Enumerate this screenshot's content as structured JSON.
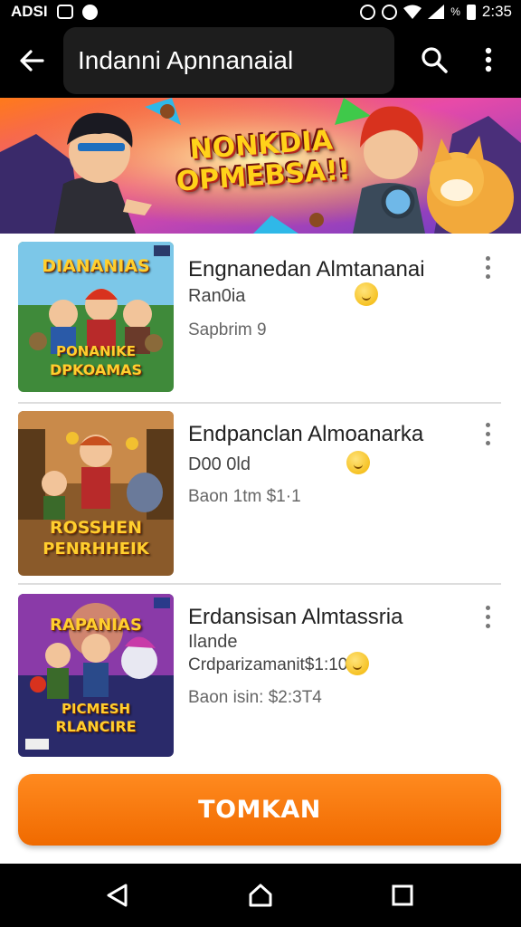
{
  "status_bar": {
    "left_text": "ADSI",
    "percent": "%",
    "time": "2:35",
    "icons": [
      "notification-box-icon",
      "notification-dot-icon",
      "alarm-icon",
      "alarm-icon",
      "wifi-icon",
      "signal-icon",
      "battery-icon"
    ]
  },
  "app_bar": {
    "title": "Indanni Apnnanaial",
    "icons": [
      "back-arrow-icon",
      "search-icon",
      "more-vert-icon"
    ]
  },
  "banner": {
    "title_line1": "NONKDIA",
    "title_line2": "OPMEBSA!!"
  },
  "items": [
    {
      "thumb_top": "DIANANIAS",
      "thumb_bottom_1": "PONANIKE",
      "thumb_bottom_2": "DPKOAMAS",
      "title": "Engnanedan Almtananai",
      "subtitle": "Ran0ia",
      "meta": "Sapbrim 9"
    },
    {
      "thumb_top": "",
      "thumb_bottom_1": "ROSSHEN",
      "thumb_bottom_2": "PENRHHEIK",
      "title": "Endpanclan Almoanarka",
      "subtitle": "D00 0ld",
      "meta": "Baon 1tm $1·1"
    },
    {
      "thumb_top": "RAPANIAS",
      "thumb_bottom_1": "PICMESH",
      "thumb_bottom_2": "RLANCIRE",
      "title": "Erdansisan Almtassria",
      "subtitle": "Ilande",
      "subtitle2": "Crdparizamanit$1:10",
      "meta": "Baon isin: $2:3T4"
    }
  ],
  "cta": {
    "label": "TOMKAN"
  },
  "nav": {
    "icons": [
      "back-triangle-icon",
      "home-icon",
      "recents-square-icon"
    ]
  },
  "colors": {
    "accent": "#f47a0c",
    "app_bar": "#000000",
    "title_pill": "#1d1d1d"
  }
}
